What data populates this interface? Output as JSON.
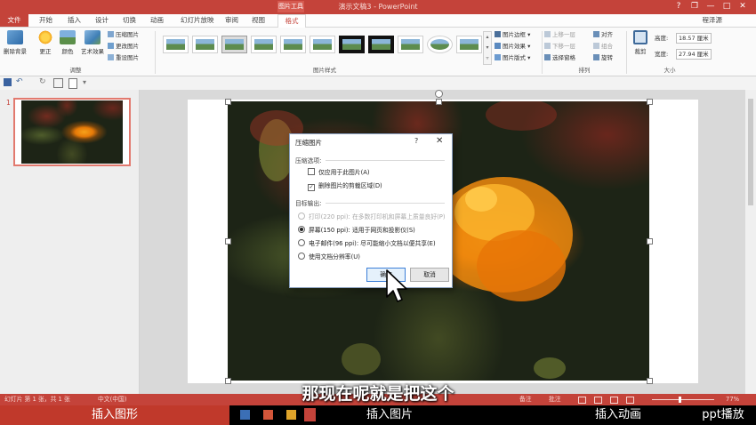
{
  "window": {
    "title": "演示文稿3 - PowerPoint",
    "context_tab": "图片工具",
    "user": "程泽源",
    "controls": {
      "help": "?",
      "restore": "❐",
      "minimize": "—",
      "maximize": "□",
      "close": "✕"
    }
  },
  "tabs": [
    "文件",
    "开始",
    "插入",
    "设计",
    "切换",
    "动画",
    "幻灯片放映",
    "审阅",
    "视图",
    "格式"
  ],
  "ribbon": {
    "adjust": {
      "remove_bg": "删除背景",
      "correct": "更正",
      "color": "颜色",
      "art_effect": "艺术效果",
      "compress": "压缩图片",
      "change": "更改图片",
      "reset": "重设图片",
      "label": "调整"
    },
    "styles": {
      "label": "图片样式",
      "border": "图片边框",
      "effect": "图片效果",
      "layout": "图片版式"
    },
    "arrange": {
      "forward": "上移一层",
      "backward": "下移一层",
      "selection_pane": "选择窗格",
      "align": "对齐",
      "group": "组合",
      "rotate": "旋转",
      "label": "排列"
    },
    "size": {
      "crop": "裁剪",
      "height_label": "高度:",
      "height_value": "18.57 厘米",
      "width_label": "宽度:",
      "width_value": "27.94 厘米",
      "label": "大小"
    }
  },
  "thumbnail": {
    "number": "1"
  },
  "dialog": {
    "title": "压缩图片",
    "help": "?",
    "close": "✕",
    "compress_section": "压缩选项:",
    "only_this": "仅应用于此图片(A)",
    "delete_cropped": "删除图片的剪裁区域(D)",
    "output_section": "目标输出:",
    "print": "打印(220 ppi): 在多数打印机和屏幕上质量良好(P)",
    "screen": "屏幕(150 ppi): 适用于网页和投影仪(S)",
    "email": "电子邮件(96 ppi): 尽可能缩小文档以便共享(E)",
    "doc_res": "使用文档分辨率(U)",
    "ok": "确定",
    "cancel": "取消"
  },
  "status": {
    "slide_info": "幻灯片 第 1 张，共 1 张",
    "language": "中文(中国)",
    "notes": "备注",
    "comments": "批注",
    "zoom": "77%"
  },
  "subtitle": "那现在呢就是把这个",
  "bottom_nav": [
    "插入图形",
    "插入图片",
    "插入动画",
    "ppt播放"
  ],
  "colors": {
    "accent": "#c4433a",
    "dialog_border": "#8aa0c0",
    "marigold": "#f39a16"
  }
}
